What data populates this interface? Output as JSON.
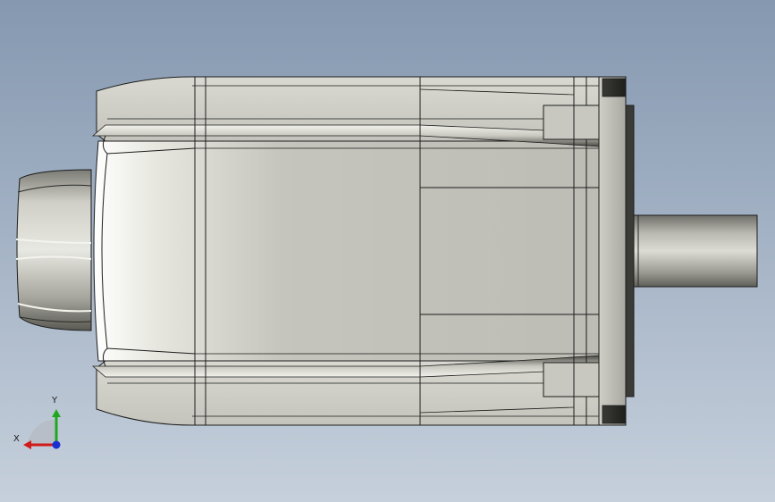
{
  "viewport": {
    "background_top": "#8598b0",
    "background_bottom": "#c6d0dc"
  },
  "model": {
    "name": "servo-motor",
    "body_color": "#c2c2ba",
    "edge_color": "#1c1c1c"
  },
  "triad": {
    "x_label": "X",
    "y_label": "Y",
    "x_color": "#d11a1a",
    "y_color": "#1fa81f",
    "z_color": "#1a2fd1"
  }
}
